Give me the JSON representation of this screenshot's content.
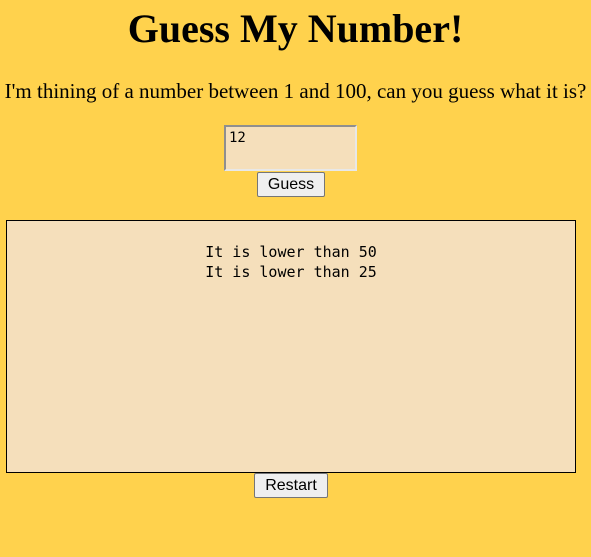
{
  "header": {
    "title": "Guess My Number!",
    "prompt": "I'm thining of a number between 1 and 100, can you guess what it is?"
  },
  "guess": {
    "input_value": "12",
    "button_label": "Guess"
  },
  "output": {
    "lines": [
      "It is lower than 50",
      "It is lower than 25"
    ]
  },
  "restart": {
    "button_label": "Restart"
  },
  "colors": {
    "background": "#ffd24d",
    "panel": "#f5dfbb"
  }
}
